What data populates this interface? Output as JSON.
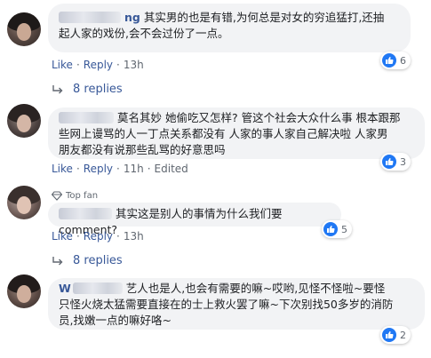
{
  "common": {
    "like": "Like",
    "reply": "Reply",
    "dot": "·"
  },
  "colors": {
    "link": "#385898",
    "bubble": "#f2f3f5",
    "like_badge": "#2078f4",
    "meta": "#606770"
  },
  "comments": [
    {
      "author_suffix": "ng",
      "line1": "其实男的也是有错,为何总是对女的穷追猛打,还抽",
      "line2": "起人家的戏份,会不会过份了一点。",
      "time": "13h",
      "likes": "6",
      "replies": "8 replies"
    },
    {
      "line1": "莫名其妙 她偷吃又怎样? 管这个社会大众什么事 根本跟那",
      "line2": "些网上谩骂的人一丁点关系都没有 人家的事人家自己解决啦 人家男",
      "line3": "朋友都没有说那些乱骂的好意思吗",
      "time": "11h",
      "edited": "Edited",
      "likes": "3"
    },
    {
      "badge": "Top fan",
      "line1": "其实这是别人的事情为什么我们要comment?",
      "time": "13h",
      "likes": "5",
      "replies": "8 replies"
    },
    {
      "author_prefix": "W",
      "line1": "艺人也是人,也会有需要的嘛~哎哟,见怪不怪啦~要怪",
      "line2": "只怪火烧太猛需要直接在的士上救火罢了嘛~下次别找50多岁的消防",
      "line3": "员,找嫩一点的嘛好咯~",
      "likes": "2"
    }
  ]
}
